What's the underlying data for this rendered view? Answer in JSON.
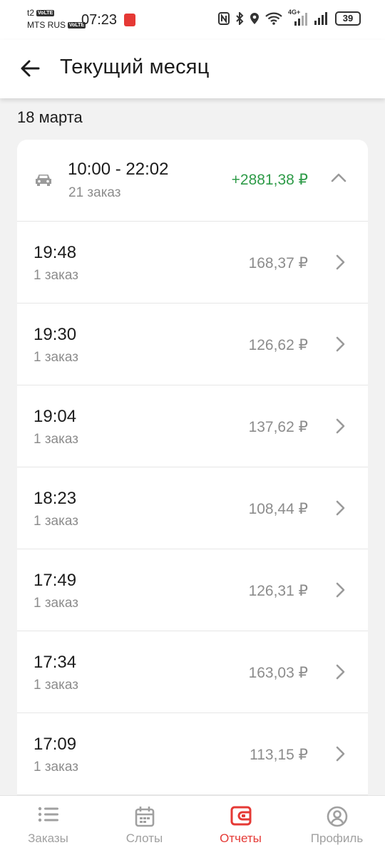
{
  "status_bar": {
    "carrier1": "t2",
    "carrier2": "MTS RUS",
    "volte": "VoLTE",
    "time": "07:23",
    "network": "4G+",
    "battery": "39"
  },
  "header": {
    "title": "Текущий месяц"
  },
  "date": "18 марта",
  "shift": {
    "time_range": "10:00 - 22:02",
    "orders": "21 заказ",
    "total": "+2881,38 ₽"
  },
  "orders": [
    {
      "time": "19:48",
      "count": "1 заказ",
      "amount": "168,37 ₽"
    },
    {
      "time": "19:30",
      "count": "1 заказ",
      "amount": "126,62 ₽"
    },
    {
      "time": "19:04",
      "count": "1 заказ",
      "amount": "137,62 ₽"
    },
    {
      "time": "18:23",
      "count": "1 заказ",
      "amount": "108,44 ₽"
    },
    {
      "time": "17:49",
      "count": "1 заказ",
      "amount": "126,31 ₽"
    },
    {
      "time": "17:34",
      "count": "1 заказ",
      "amount": "163,03 ₽"
    },
    {
      "time": "17:09",
      "count": "1 заказ",
      "amount": "113,15 ₽"
    }
  ],
  "nav": {
    "items": [
      {
        "label": "Заказы",
        "icon": "list-icon"
      },
      {
        "label": "Слоты",
        "icon": "calendar-icon"
      },
      {
        "label": "Отчеты",
        "icon": "wallet-icon"
      },
      {
        "label": "Профиль",
        "icon": "profile-icon"
      }
    ],
    "active": "Отчеты"
  },
  "colors": {
    "accent": "#e53935",
    "positive": "#2e9b48",
    "muted": "#8c8c8c"
  }
}
